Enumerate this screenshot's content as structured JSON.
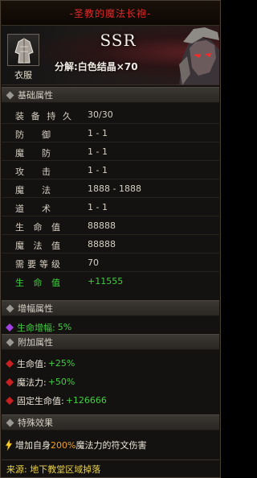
{
  "title": "-圣教的魔法长袍-",
  "header": {
    "item_type": "衣服",
    "rarity": "SSR",
    "decompose": "分解:白色结晶×70",
    "item_icon": "robe-icon",
    "portrait": "character-portrait"
  },
  "sections": {
    "base": "基础属性",
    "amplify": "增幅属性",
    "extra": "附加属性",
    "special": "特殊效果"
  },
  "base_stats": [
    {
      "name": [
        "装",
        "备",
        "持",
        "久"
      ],
      "value": "30/30"
    },
    {
      "name": [
        "防",
        "御"
      ],
      "value": "1 - 1"
    },
    {
      "name": [
        "魔",
        "防"
      ],
      "value": "1 - 1"
    },
    {
      "name": [
        "攻",
        "击"
      ],
      "value": "1 - 1"
    },
    {
      "name": [
        "魔",
        "法"
      ],
      "value": "1888 - 1888"
    },
    {
      "name": [
        "道",
        "术"
      ],
      "value": "1 - 1"
    },
    {
      "name": [
        "生",
        "命",
        "值"
      ],
      "value": "88888"
    },
    {
      "name": [
        "魔",
        "法",
        "值"
      ],
      "value": "88888"
    },
    {
      "name": [
        "需",
        "要",
        "等",
        "级"
      ],
      "value": "70"
    },
    {
      "name": [
        "生",
        "命",
        "值"
      ],
      "value": "+11555"
    }
  ],
  "amplify": {
    "label": "生命增幅:",
    "value": "5%"
  },
  "extra": [
    {
      "label": "生命值:",
      "value": "+25%"
    },
    {
      "label": "魔法力:",
      "value": "+50%"
    },
    {
      "label": "固定生命值:",
      "value": "+126666"
    }
  ],
  "special": {
    "prefix": "增加自身",
    "percent": "200%",
    "suffix": "魔法力的符文伤害"
  },
  "source": "来源: 地下教堂区域掉落",
  "colors": {
    "title": "#e0282a",
    "green": "#3fcf3f",
    "orange": "#f0a020",
    "source": "#e8d24a"
  }
}
